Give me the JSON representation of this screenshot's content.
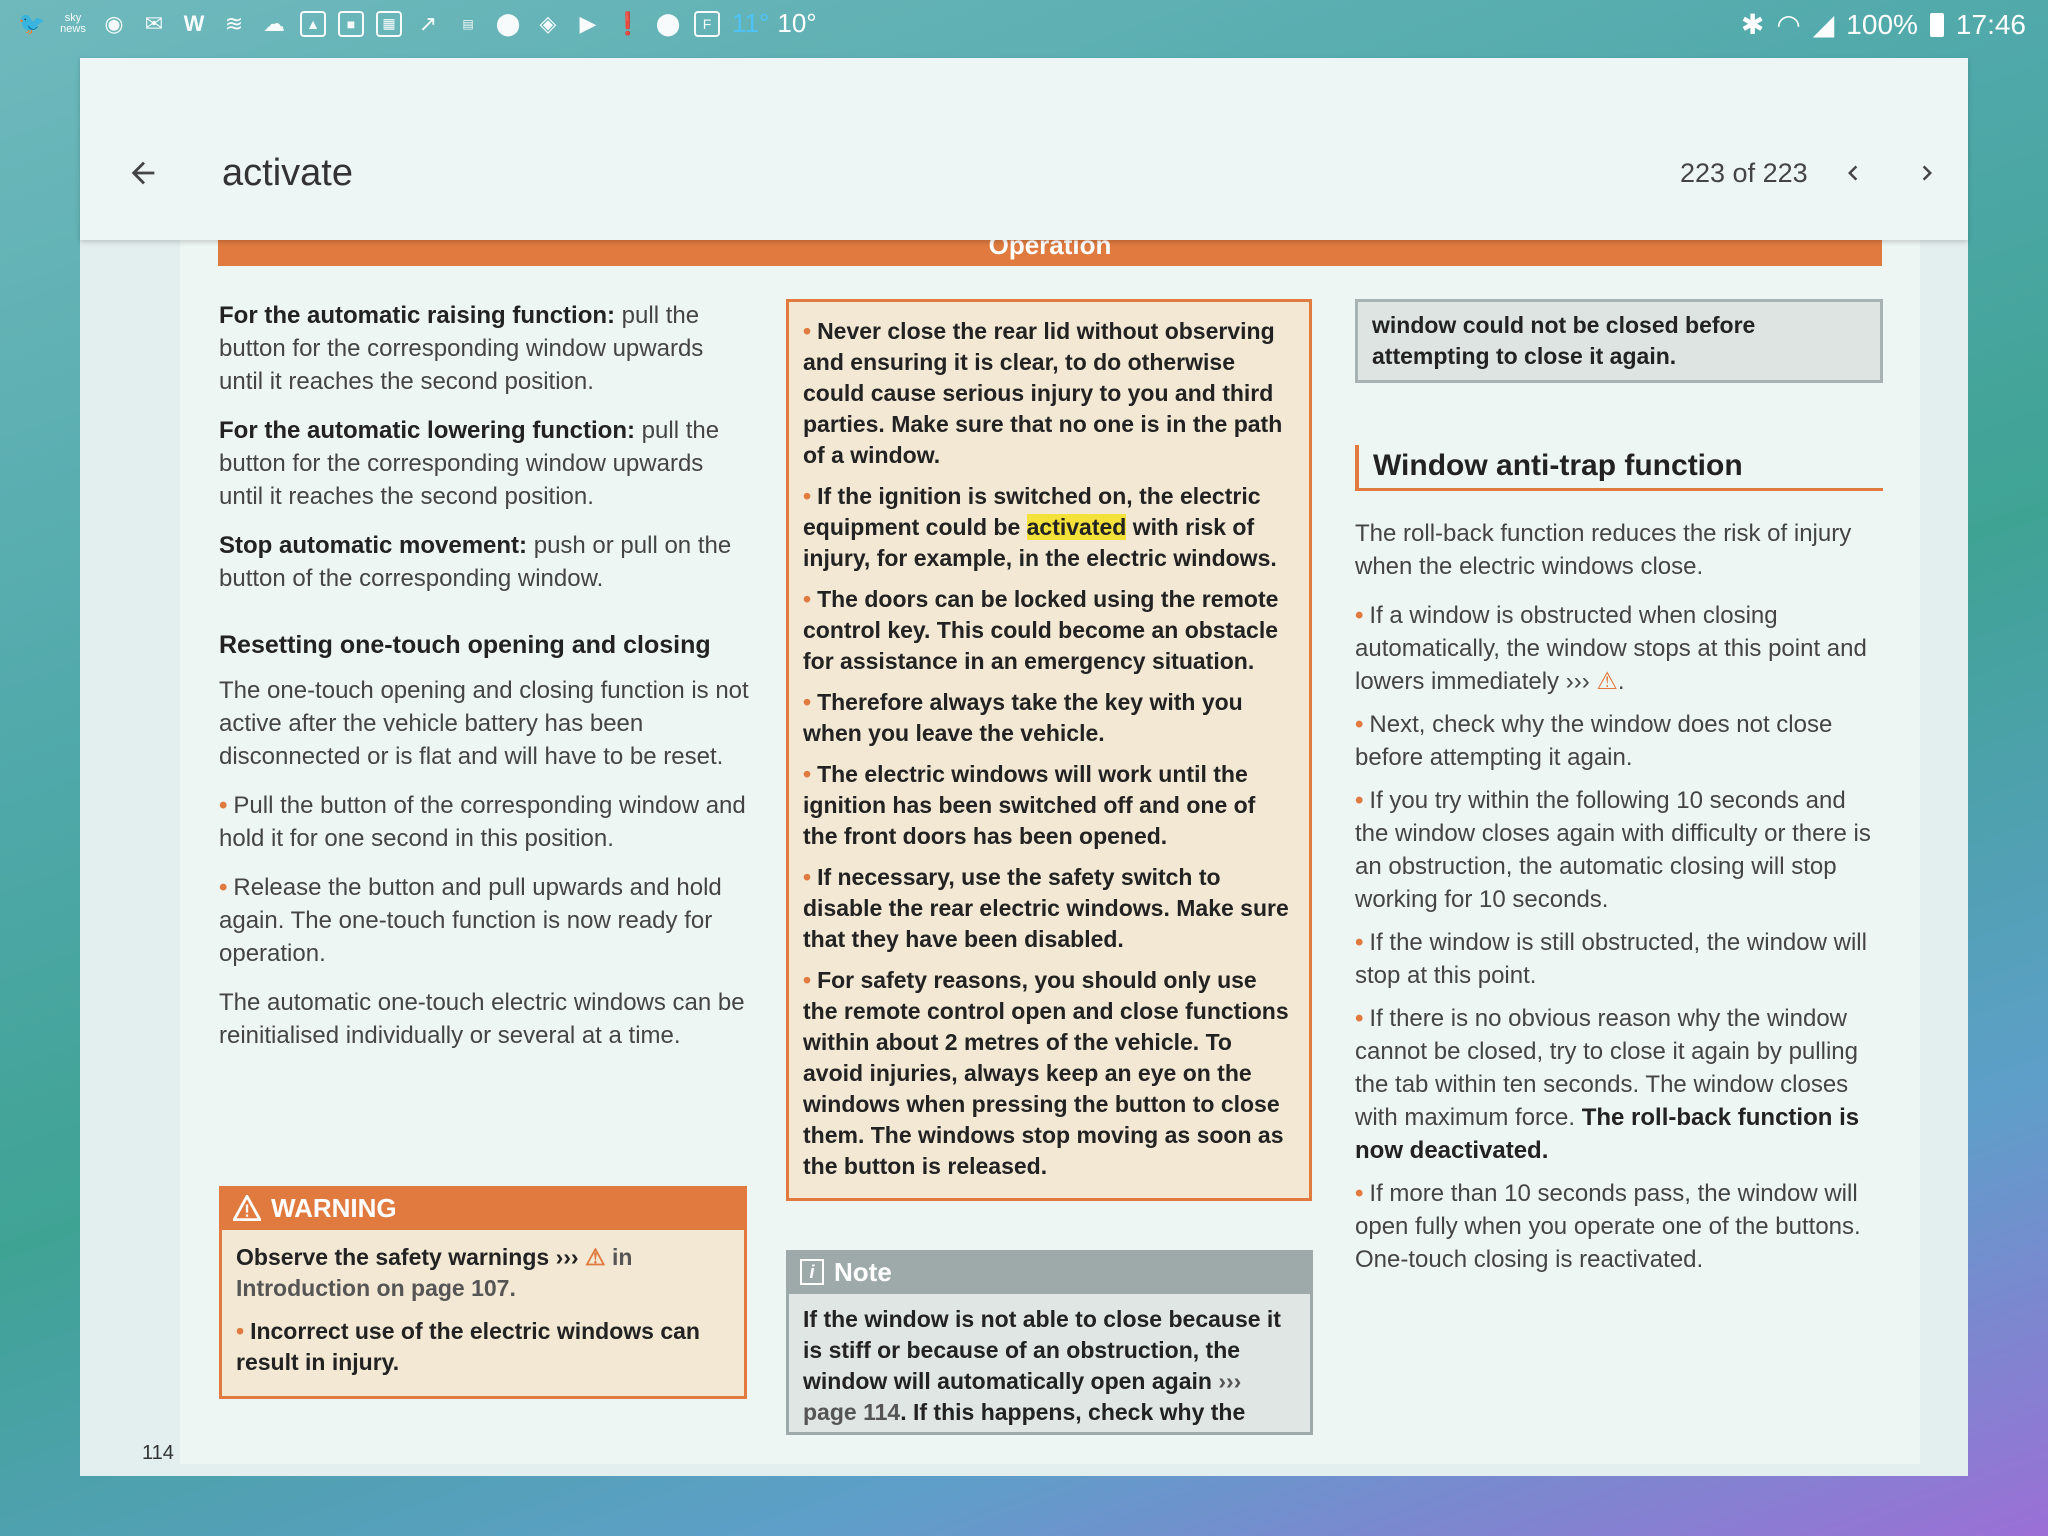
{
  "status_bar": {
    "left_icons": [
      "twitter-icon",
      "sky-news-icon",
      "globe-icon",
      "gmail-icon",
      "w-icon",
      "layers-icon",
      "cloud-icon",
      "image-icon",
      "flipboard-icon",
      "calendar-icon",
      "trending-icon",
      "news-icon",
      "location-icon",
      "maps-icon",
      "youtube-icon",
      "message-icon",
      "location-icon",
      "sim-icon"
    ],
    "sky_news_label": "sky news",
    "temp_high": "11°",
    "temp_low": "10°",
    "battery": "100%",
    "time": "17:46"
  },
  "toolbar": {
    "search_text": "activate",
    "page_count": "223 of 223"
  },
  "page": {
    "section_header": "Operation",
    "page_number": "114",
    "col1": {
      "p1_bold": "For the automatic raising function:",
      "p1_text": " pull the button for the corresponding window upwards until it reaches the second position.",
      "p2_bold": "For the automatic lowering function:",
      "p2_text": " pull the button for the corresponding window upwards until it reaches the second position.",
      "p3_bold": "Stop automatic movement:",
      "p3_text": " push or pull on the button of the corresponding window.",
      "subheading": "Resetting one-touch opening and closing",
      "p4": "The one-touch opening and closing function is not active after the vehicle battery has been disconnected or is flat and will have to be reset.",
      "b1": "Pull the button of the corresponding window and hold it for one second in this position.",
      "b2": "Release the button and pull upwards and hold again. The one-touch function is now ready for operation.",
      "p5": "The automatic one-touch electric windows can be reinitialised individually or several at a time."
    },
    "warning": {
      "title": "WARNING",
      "p1_a": "Observe the safety warnings ››› ",
      "p1_b": " in Introduction on page 107.",
      "b1": "Incorrect use of the electric windows can result in injury."
    },
    "col2": {
      "b1": "Never close the rear lid without observing and ensuring it is clear, to do otherwise could cause serious injury to you and third parties. Make sure that no one is in the path of a window.",
      "b2_a": "If the ignition is switched on, the electric equipment could be ",
      "b2_hl": "activated",
      "b2_b": " with risk of injury, for example, in the electric windows.",
      "b3": "The doors can be locked using the remote control key. This could become an obstacle for assistance in an emergency situation.",
      "b4": "Therefore always take the key with you when you leave the vehicle.",
      "b5": "The electric windows will work until the ignition has been switched off and one of the front doors has been opened.",
      "b6": "If necessary, use the safety switch to disable the rear electric windows. Make sure that they have been disabled.",
      "b7": "For safety reasons, you should only use the remote control open and close functions within about 2 metres of the vehicle. To avoid injuries, always keep an eye on the windows when pressing the button to close them. The windows stop moving as soon as the button is released."
    },
    "note": {
      "title": "Note",
      "text_a": "If the window is not able to close because it is stiff or because of an obstruction, the window will automatically open again ",
      "link": "››› page 114",
      "text_b": ". If this happens, check why the"
    },
    "col3": {
      "continued": "window could not be closed before attempting to close it again.",
      "section_title": "Window anti-trap function",
      "intro": "The roll-back function reduces the risk of injury when the electric windows close.",
      "b1_a": "If a window is obstructed when closing automatically, the window stops at this point and lowers immediately ››› ",
      "b1_b": ".",
      "b2": "Next, check why the window does not close before attempting it again.",
      "b3": "If you try within the following 10 seconds and the window closes again with difficulty or there is an obstruction, the automatic closing will stop working for 10 seconds.",
      "b4": "If the window is still obstructed, the window will stop at this point.",
      "b5_a": "If there is no obvious reason why the window cannot be closed, try to close it again by pulling the tab within ten seconds. The window closes with maximum force. ",
      "b5_bold": "The roll-back function is now deactivated.",
      "b6": "If more than 10 seconds pass, the window will open fully when you operate one of the buttons. One-touch closing is reactivated."
    }
  },
  "colors": {
    "accent": "#e07a3f",
    "highlight": "#f4e23a",
    "note_grey": "#9ea9aa"
  }
}
